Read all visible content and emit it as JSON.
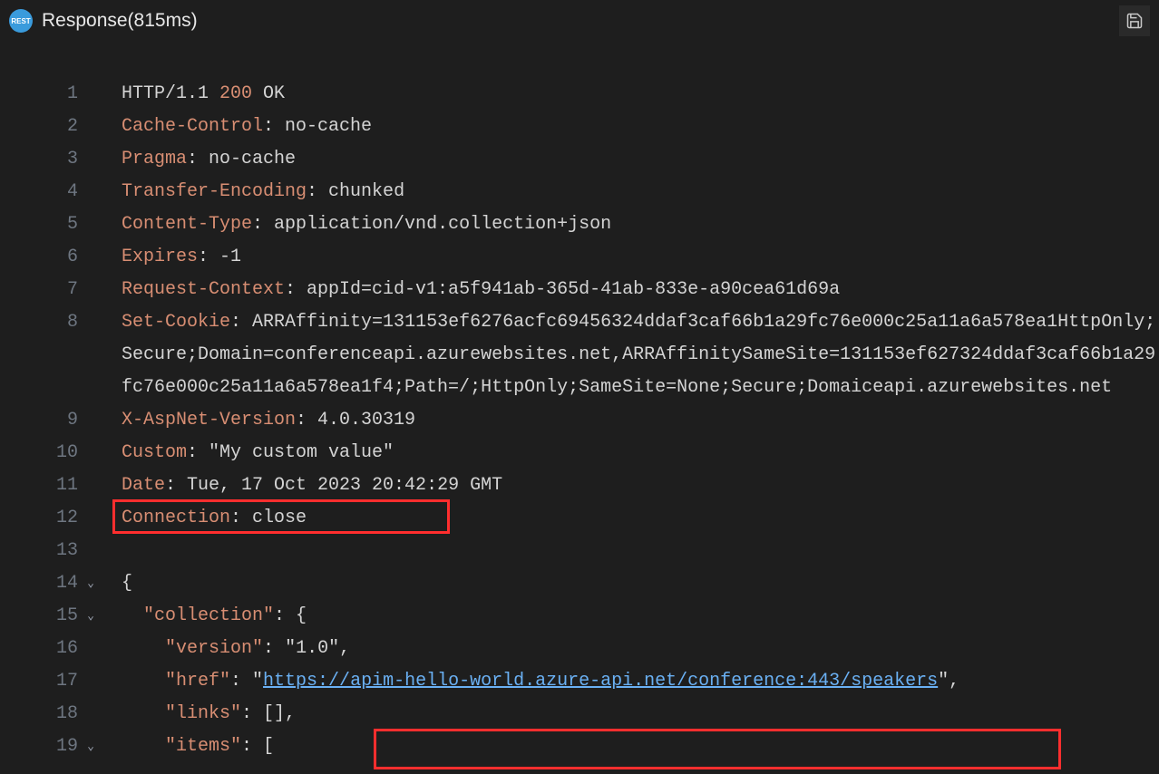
{
  "header": {
    "title": "Response(815ms)",
    "icon_label": "REST"
  },
  "lines": [
    {
      "num": "1",
      "fold": "",
      "indent": 0,
      "tokens": [
        {
          "cls": "tok-plain",
          "t": "HTTP/1.1 "
        },
        {
          "cls": "tok-num",
          "t": "200"
        },
        {
          "cls": "tok-plain",
          "t": " OK"
        }
      ]
    },
    {
      "num": "2",
      "fold": "",
      "indent": 0,
      "tokens": [
        {
          "cls": "tok-key",
          "t": "Cache-Control"
        },
        {
          "cls": "tok-plain",
          "t": ": no-cache"
        }
      ]
    },
    {
      "num": "3",
      "fold": "",
      "indent": 0,
      "tokens": [
        {
          "cls": "tok-key",
          "t": "Pragma"
        },
        {
          "cls": "tok-plain",
          "t": ": no-cache"
        }
      ]
    },
    {
      "num": "4",
      "fold": "",
      "indent": 0,
      "tokens": [
        {
          "cls": "tok-key",
          "t": "Transfer-Encoding"
        },
        {
          "cls": "tok-plain",
          "t": ": chunked"
        }
      ]
    },
    {
      "num": "5",
      "fold": "",
      "indent": 0,
      "tokens": [
        {
          "cls": "tok-key",
          "t": "Content-Type"
        },
        {
          "cls": "tok-plain",
          "t": ": application/vnd.collection+json"
        }
      ]
    },
    {
      "num": "6",
      "fold": "",
      "indent": 0,
      "tokens": [
        {
          "cls": "tok-key",
          "t": "Expires"
        },
        {
          "cls": "tok-plain",
          "t": ": -1"
        }
      ]
    },
    {
      "num": "7",
      "fold": "",
      "indent": 0,
      "tokens": [
        {
          "cls": "tok-key",
          "t": "Request-Context"
        },
        {
          "cls": "tok-plain",
          "t": ": appId=cid-v1:a5f941ab-365d-41ab-833e-a90cea61d69a"
        }
      ]
    },
    {
      "num": "8",
      "fold": "",
      "indent": 0,
      "tokens": [
        {
          "cls": "tok-key",
          "t": "Set-Cookie"
        },
        {
          "cls": "tok-plain",
          "t": ": ARRAffinity=131153ef6276acfc69456324ddaf3caf66b1a29fc76e000c25a11a6a578ea1HttpOnly;Secure;Domain=conferenceapi.azurewebsites.net,ARRAffinitySameSite=131153ef627324ddaf3caf66b1a29fc76e000c25a11a6a578ea1f4;Path=/;HttpOnly;SameSite=None;Secure;Domaiceapi.azurewebsites.net"
        }
      ]
    },
    {
      "num": "9",
      "fold": "",
      "indent": 0,
      "tokens": [
        {
          "cls": "tok-key",
          "t": "X-AspNet-Version"
        },
        {
          "cls": "tok-plain",
          "t": ": 4.0.30319"
        }
      ]
    },
    {
      "num": "10",
      "fold": "",
      "indent": 0,
      "tokens": [
        {
          "cls": "tok-key",
          "t": "Custom"
        },
        {
          "cls": "tok-plain",
          "t": ": \"My custom value\""
        }
      ]
    },
    {
      "num": "11",
      "fold": "",
      "indent": 0,
      "tokens": [
        {
          "cls": "tok-key",
          "t": "Date"
        },
        {
          "cls": "tok-plain",
          "t": ": Tue, 17 Oct 2023 20:42:29 GMT"
        }
      ]
    },
    {
      "num": "12",
      "fold": "",
      "indent": 0,
      "tokens": [
        {
          "cls": "tok-key",
          "t": "Connection"
        },
        {
          "cls": "tok-plain",
          "t": ": close"
        }
      ]
    },
    {
      "num": "13",
      "fold": "",
      "indent": 0,
      "tokens": []
    },
    {
      "num": "14",
      "fold": "⌄",
      "indent": 0,
      "tokens": [
        {
          "cls": "tok-sym",
          "t": "{"
        }
      ]
    },
    {
      "num": "15",
      "fold": "⌄",
      "indent": 1,
      "tokens": [
        {
          "cls": "tok-key",
          "t": "\"collection\""
        },
        {
          "cls": "tok-sym",
          "t": ": {"
        }
      ]
    },
    {
      "num": "16",
      "fold": "",
      "indent": 2,
      "tokens": [
        {
          "cls": "tok-key",
          "t": "\"version\""
        },
        {
          "cls": "tok-sym",
          "t": ": "
        },
        {
          "cls": "tok-str",
          "t": "\"1.0\""
        },
        {
          "cls": "tok-sym",
          "t": ","
        }
      ]
    },
    {
      "num": "17",
      "fold": "",
      "indent": 2,
      "tokens": [
        {
          "cls": "tok-key",
          "t": "\"href\""
        },
        {
          "cls": "tok-sym",
          "t": ": \""
        },
        {
          "cls": "tok-link",
          "t": "https://apim-hello-world.azure-api.net/conference:443/speakers"
        },
        {
          "cls": "tok-sym",
          "t": "\","
        }
      ]
    },
    {
      "num": "18",
      "fold": "",
      "indent": 2,
      "tokens": [
        {
          "cls": "tok-key",
          "t": "\"links\""
        },
        {
          "cls": "tok-sym",
          "t": ": [],"
        }
      ]
    },
    {
      "num": "19",
      "fold": "⌄",
      "indent": 2,
      "tokens": [
        {
          "cls": "tok-key",
          "t": "\"items\""
        },
        {
          "cls": "tok-sym",
          "t": ": ["
        }
      ]
    }
  ],
  "highlights": {
    "custom_header": "Custom: \"My custom value\"",
    "url": "apim-hello-world.azure-api.net/conference:443/speakers"
  }
}
